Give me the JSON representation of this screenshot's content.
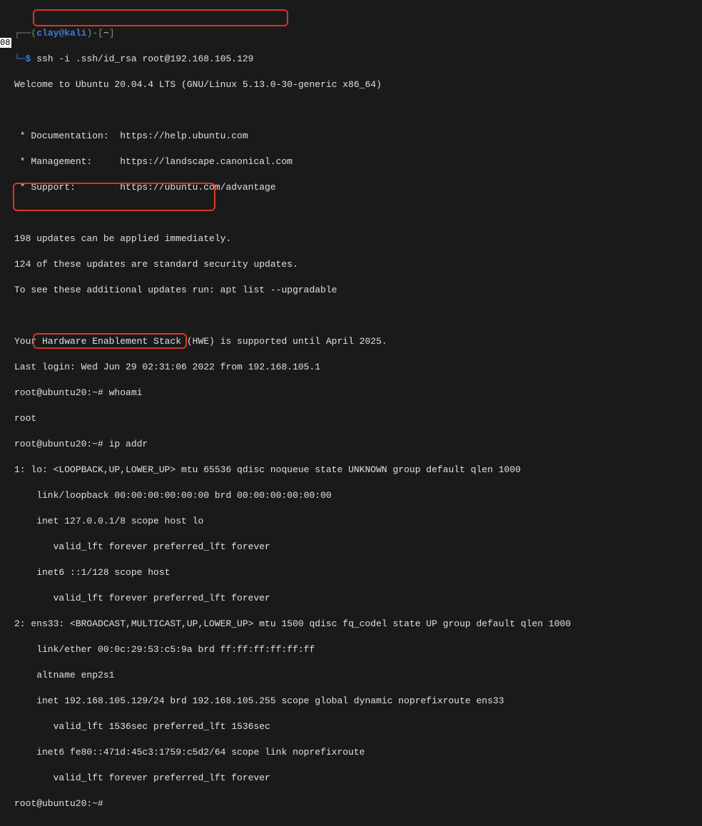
{
  "kali": {
    "prefix": "┌──(",
    "user": "clay",
    "at": "@",
    "host": "kali",
    "suffix": ")-[",
    "path": "~",
    "close": "]",
    "dollar_line": "└─$ ",
    "command": "ssh -i .ssh/id_rsa root@192.168.105.129"
  },
  "motd": {
    "welcome": "Welcome to Ubuntu 20.04.4 LTS (GNU/Linux 5.13.0-30-generic x86_64)",
    "doc": " * Documentation:  https://help.ubuntu.com",
    "mgmt": " * Management:     https://landscape.canonical.com",
    "supp": " * Support:        https://ubuntu.com/advantage",
    "upd1": "198 updates can be applied immediately.",
    "upd2": "124 of these updates are standard security updates.",
    "upd3": "To see these additional updates run: apt list --upgradable",
    "hwe": "Your Hardware Enablement Stack (HWE) is supported until April 2025.",
    "last": "Last login: Wed Jun 29 02:31:06 2022 from 192.168.105.1"
  },
  "sess": {
    "prompt": "root@ubuntu20:~# ",
    "whoami_cmd": "whoami",
    "whoami_out": "root",
    "ipaddr_cmd": "ip addr"
  },
  "ip": {
    "lo1": "1: lo: <LOOPBACK,UP,LOWER_UP> mtu 65536 qdisc noqueue state UNKNOWN group default qlen 1000",
    "lo2": "    link/loopback 00:00:00:00:00:00 brd 00:00:00:00:00:00",
    "lo3": "    inet 127.0.0.1/8 scope host lo",
    "lo4": "       valid_lft forever preferred_lft forever",
    "lo5": "    inet6 ::1/128 scope host ",
    "lo6": "       valid_lft forever preferred_lft forever",
    "e1": "2: ens33: <BROADCAST,MULTICAST,UP,LOWER_UP> mtu 1500 qdisc fq_codel state UP group default qlen 1000",
    "e2": "    link/ether 00:0c:29:53:c5:9a brd ff:ff:ff:ff:ff:ff",
    "e3": "    altname enp2s1",
    "e4": "    inet 192.168.105.129/24 brd 192.168.105.255 scope global dynamic noprefixroute ens33",
    "e5": "       valid_lft 1536sec preferred_lft 1536sec",
    "e6": "    inet6 fe80::471d:45c3:1759:c5d2/64 scope link noprefixroute ",
    "e7": "       valid_lft forever preferred_lft forever"
  },
  "final_prompt": "root@ubuntu20:~# ",
  "side_label": "08"
}
